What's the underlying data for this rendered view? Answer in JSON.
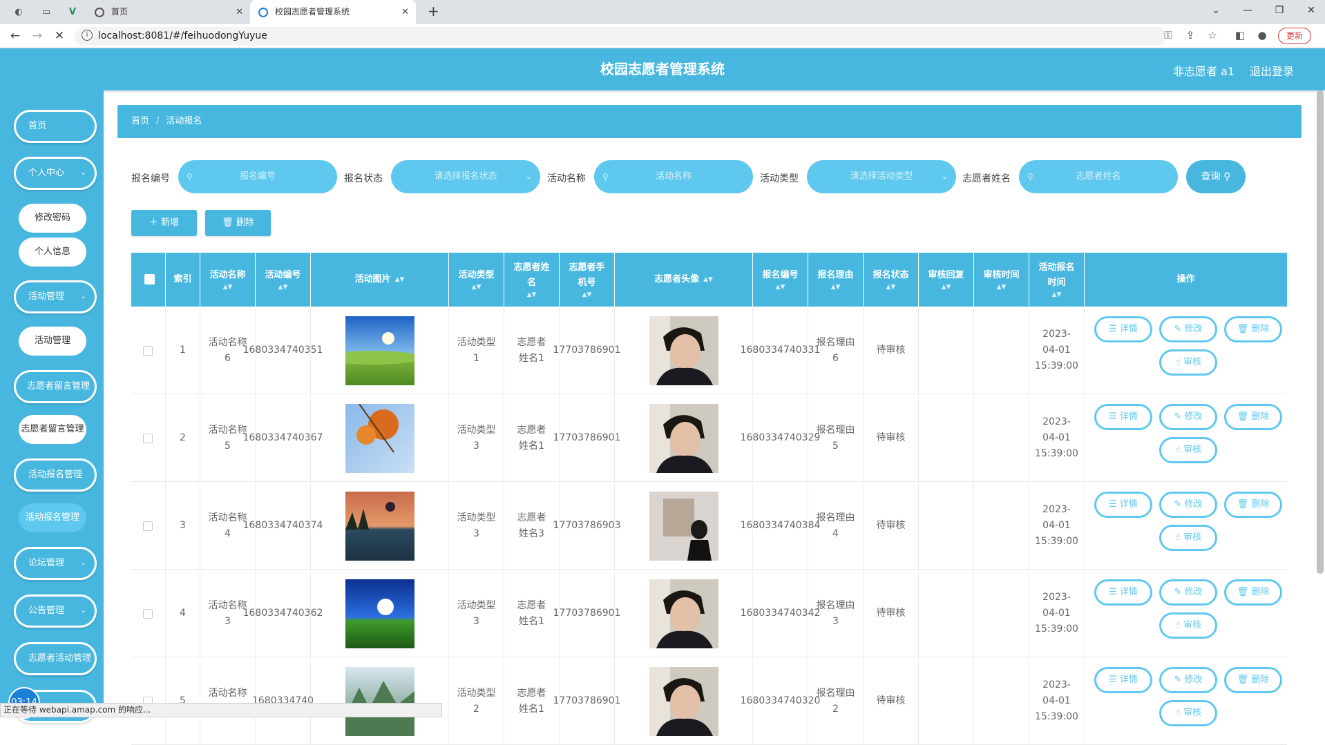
{
  "browser": {
    "tabs": [
      {
        "title": "首页"
      },
      {
        "title": "校园志愿者管理系统"
      }
    ],
    "url": "localhost:8081/#/feihuodongYuyue",
    "update_label": "更新",
    "status_text": "正在等待 webapi.amap.com 的响应..."
  },
  "header": {
    "title": "校园志愿者管理系统",
    "user": "非志愿者 a1",
    "logout": "退出登录"
  },
  "sidebar": {
    "items": [
      {
        "label": "首页"
      },
      {
        "label": "个人中心"
      },
      {
        "label": "修改密码"
      },
      {
        "label": "个人信息"
      },
      {
        "label": "活动管理"
      },
      {
        "label": "活动管理"
      },
      {
        "label": "志愿者留言管理"
      },
      {
        "label": "志愿者留言管理"
      },
      {
        "label": "活动报名管理"
      },
      {
        "label": "活动报名管理"
      },
      {
        "label": "论坛管理"
      },
      {
        "label": "公告管理"
      },
      {
        "label": "志愿者活动管理"
      }
    ],
    "timer": "03:14"
  },
  "breadcrumb": {
    "home": "首页",
    "current": "活动报名"
  },
  "filters": {
    "f1_label": "报名编号",
    "f1_placeholder": "报名编号",
    "f2_label": "报名状态",
    "f2_placeholder": "请选择报名状态",
    "f3_label": "活动名称",
    "f3_placeholder": "活动名称",
    "f4_label": "活动类型",
    "f4_placeholder": "请选择活动类型",
    "f5_label": "志愿者姓名",
    "f5_placeholder": "志愿者姓名",
    "search": "查询"
  },
  "actions": {
    "add": "新增",
    "delete": "删除"
  },
  "table": {
    "headers": [
      "索引",
      "活动名称",
      "活动编号",
      "活动图片",
      "活动类型",
      "志愿者姓名",
      "志愿者手机号",
      "志愿者头像",
      "报名编号",
      "报名理由",
      "报名状态",
      "审核回复",
      "审核时间",
      "活动报名时间",
      "操作"
    ],
    "ops": {
      "detail": "详情",
      "edit": "修改",
      "delete": "删除",
      "audit": "审核"
    },
    "rows": [
      {
        "idx": "1",
        "name": "活动名称6",
        "code": "1680334740351",
        "type": "活动类型1",
        "vname": "志愿者姓名1",
        "phone": "17703786901",
        "regno": "1680334740331",
        "reason": "报名理由6",
        "status": "待审核",
        "reply": "",
        "atime": "",
        "time": "2023-04-01 15:39:00",
        "img": "sky"
      },
      {
        "idx": "2",
        "name": "活动名称5",
        "code": "1680334740367",
        "type": "活动类型3",
        "vname": "志愿者姓名1",
        "phone": "17703786901",
        "regno": "1680334740329",
        "reason": "报名理由5",
        "status": "待审核",
        "reply": "",
        "atime": "",
        "time": "2023-04-01 15:39:00",
        "img": "autumn"
      },
      {
        "idx": "3",
        "name": "活动名称4",
        "code": "1680334740374",
        "type": "活动类型3",
        "vname": "志愿者姓名3",
        "phone": "17703786903",
        "regno": "1680334740384",
        "reason": "报名理由4",
        "status": "待审核",
        "reply": "",
        "atime": "",
        "time": "2023-04-01 15:39:00",
        "img": "dusk"
      },
      {
        "idx": "4",
        "name": "活动名称3",
        "code": "1680334740362",
        "type": "活动类型3",
        "vname": "志愿者姓名1",
        "phone": "17703786901",
        "regno": "1680334740342",
        "reason": "报名理由3",
        "status": "待审核",
        "reply": "",
        "atime": "",
        "time": "2023-04-01 15:39:00",
        "img": "field"
      },
      {
        "idx": "5",
        "name": "活动名称2",
        "code": "1680334740",
        "type": "活动类型2",
        "vname": "志愿者姓名1",
        "phone": "17703786901",
        "regno": "1680334740320",
        "reason": "报名理由2",
        "status": "待审核",
        "reply": "",
        "atime": "",
        "time": "2023-04-01 15:39:00",
        "img": "mountain"
      }
    ]
  },
  "colors": {
    "primary": "#47b7e0",
    "light": "#5ec8ee"
  }
}
